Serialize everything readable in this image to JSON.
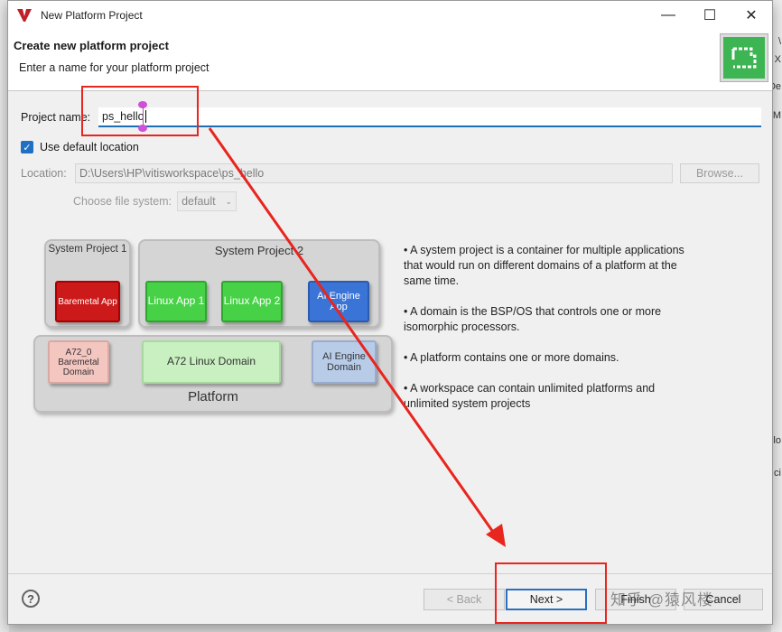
{
  "background": {
    "right_fragments": [
      "\\",
      "X",
      "De",
      "M",
      "olo",
      "ci"
    ]
  },
  "window": {
    "title": "New Platform Project",
    "controls": {
      "minimize": "—",
      "maximize": "☐",
      "close": "✕"
    }
  },
  "header": {
    "title": "Create new platform project",
    "subtitle": "Enter a name for your platform project"
  },
  "form": {
    "project_name_label": "Project name:",
    "project_name_value": "ps_hello",
    "use_default_location_label": "Use default location",
    "use_default_location_checked": true,
    "location_label": "Location:",
    "location_value": "D:\\Users\\HP\\vitisworkspace\\ps_hello",
    "browse_label": "Browse...",
    "file_system_label": "Choose file system:",
    "file_system_value": "default"
  },
  "diagram": {
    "system_project_1": "System Project 1",
    "system_project_2": "System Project 2",
    "baremetal_app": "Baremetal App",
    "linux_app_1": "Linux App 1",
    "linux_app_2": "Linux App 2",
    "ai_engine_app": "AI Engine App",
    "a72_0_domain": "A72_0 Baremetal Domain",
    "a72_linux_domain": "A72 Linux Domain",
    "ai_engine_domain": "AI Engine Domain",
    "platform": "Platform"
  },
  "info": [
    "• A system project is a container for multiple applications that would run on different domains of a platform at the same time.",
    "• A domain is the BSP/OS that controls one or more isomorphic processors.",
    "• A platform contains one or more domains.",
    "• A workspace can contain unlimited platforms and unlimited system projects"
  ],
  "footer": {
    "help": "?",
    "back_label": "< Back",
    "next_label": "Next >",
    "finish_label": "Finish",
    "cancel_label": "Cancel",
    "watermark": "知乎 @猿风楼"
  },
  "colors": {
    "accent": "#1c6fb5",
    "highlight": "#e8251e",
    "brand_green": "#3db552"
  }
}
